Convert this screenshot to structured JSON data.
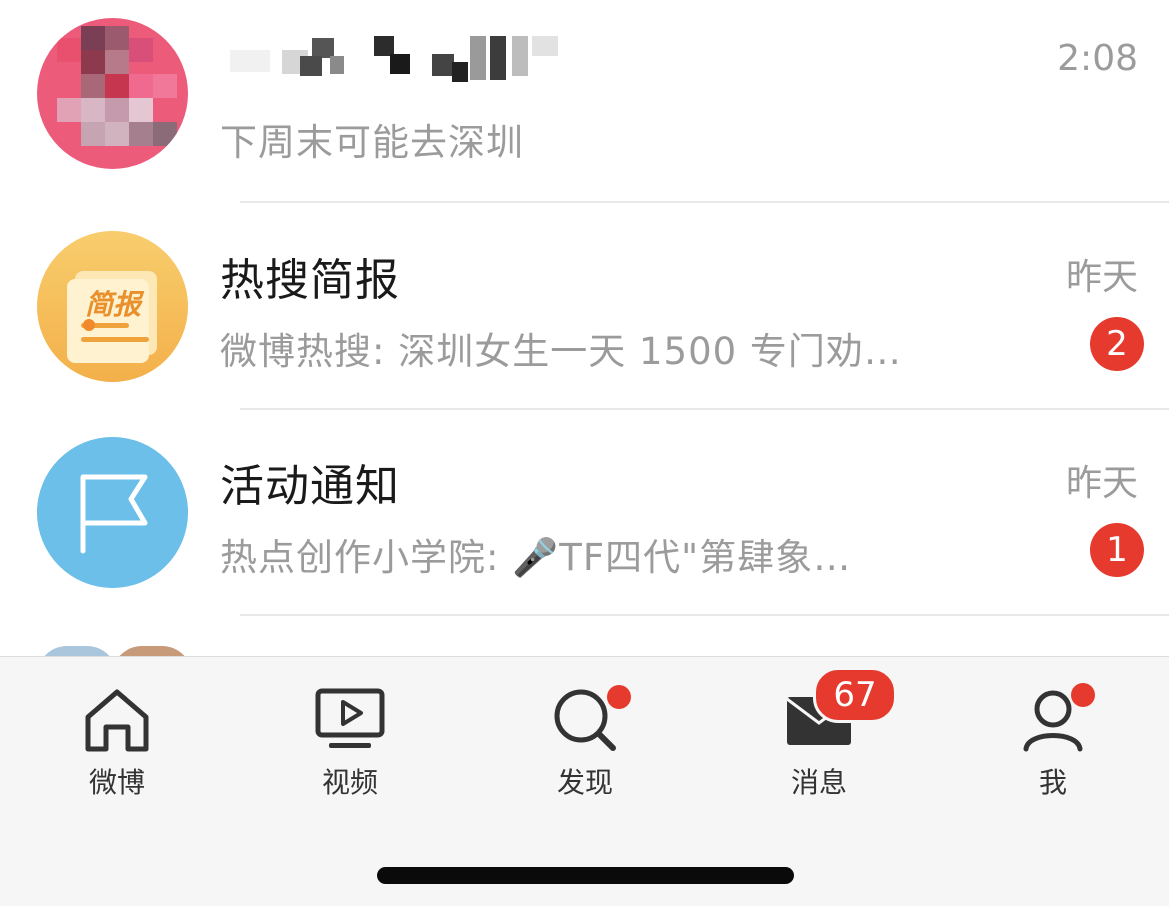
{
  "conversations": [
    {
      "name": "",
      "time": "2:08",
      "preview": "下周末可能去深圳",
      "badge": null
    },
    {
      "name": "热搜简报",
      "avatar_text": "简报",
      "time": "昨天",
      "preview": "微博热搜: 深圳女生一天 1500 专门劝…",
      "badge": "2"
    },
    {
      "name": "活动通知",
      "time": "昨天",
      "preview": "热点创作小学院: 🎤TF四代\"第肆象…",
      "badge": "1"
    }
  ],
  "tabbar": {
    "tabs": [
      {
        "label": "微博",
        "icon": "home-icon"
      },
      {
        "label": "视频",
        "icon": "video-icon"
      },
      {
        "label": "发现",
        "icon": "search-icon",
        "dot": true
      },
      {
        "label": "消息",
        "icon": "mail-icon",
        "badge": "67"
      },
      {
        "label": "我",
        "icon": "profile-icon",
        "dot": true
      }
    ]
  },
  "colors": {
    "badge_red": "#e63a2e",
    "secondary_text": "#9b9b9b",
    "avatar_hot_orange": "#f5c15a",
    "avatar_event_blue": "#6bbfe8"
  }
}
